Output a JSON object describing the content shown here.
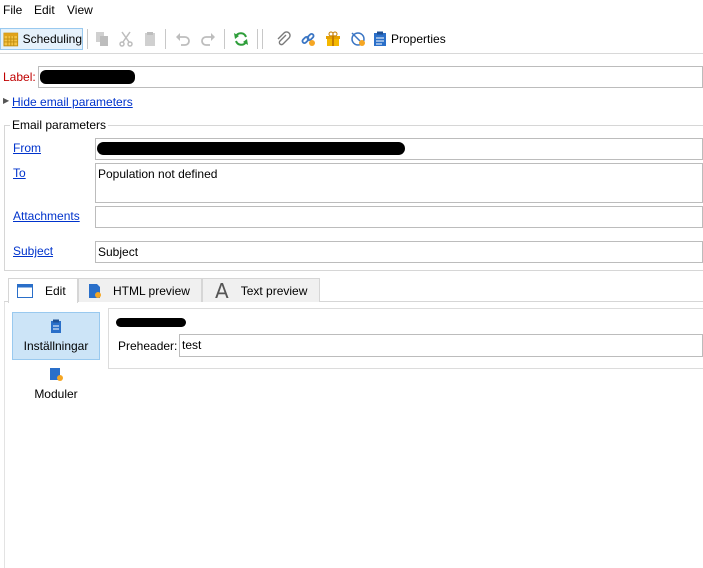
{
  "menu": [
    "File",
    "Edit",
    "View"
  ],
  "toolbar": {
    "scheduling_label": "Scheduling",
    "properties_label": "Properties"
  },
  "form": {
    "label_caption": "Label:",
    "hide_params_link": "Hide email parameters",
    "email_params_title": "Email parameters",
    "from_label": "From",
    "to_label": "To",
    "to_value": "Population not defined",
    "attachments_label": "Attachments",
    "subject_label": "Subject",
    "subject_value": "Subject"
  },
  "tabs": [
    {
      "label": "Edit"
    },
    {
      "label": "HTML preview"
    },
    {
      "label": "Text preview"
    }
  ],
  "side_panel": {
    "settings_label": "Inställningar",
    "modules_label": "Moduler"
  },
  "content": {
    "preheader_label": "Preheader:",
    "preheader_value": "test"
  },
  "colors": {
    "link": "#0033cc",
    "label_red": "#c00000",
    "selected_bg": "#cce4f7",
    "selected_border": "#99c9ef"
  }
}
